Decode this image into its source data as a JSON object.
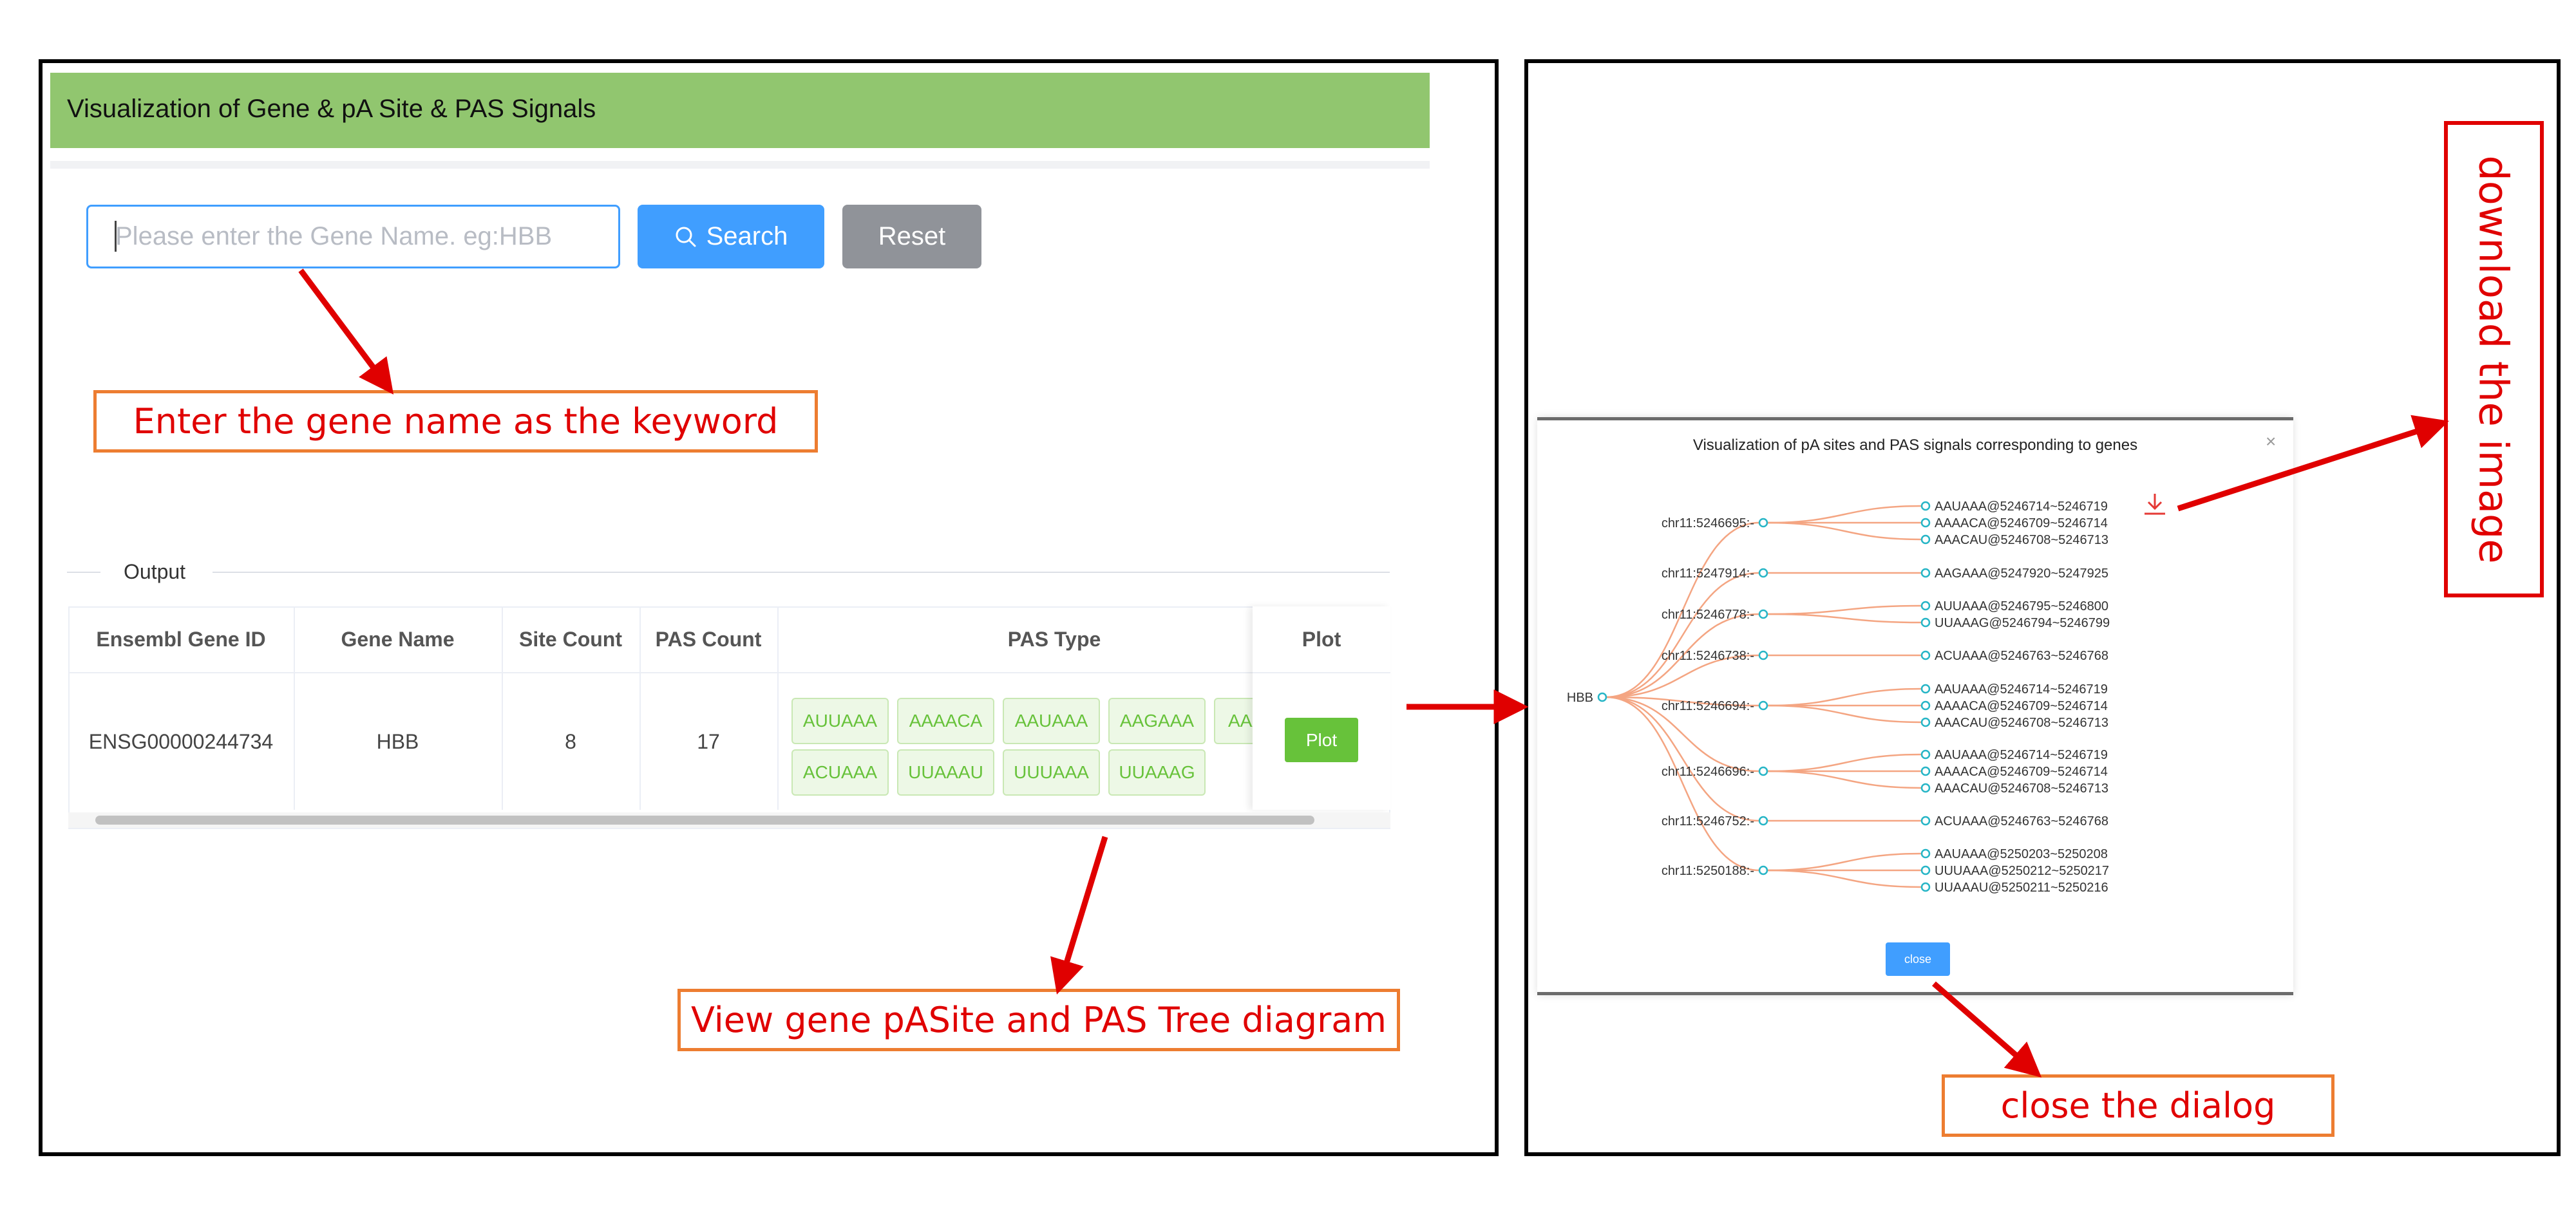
{
  "left_panel": {
    "title": "Visualization of Gene & pA Site & PAS Signals",
    "search": {
      "placeholder": "Please enter the Gene Name. eg:HBB",
      "button_label": "Search"
    },
    "reset_label": "Reset",
    "callout_search": "Enter the gene name as the keyword",
    "output_label": "Output",
    "table": {
      "headers": [
        "Ensembl Gene ID",
        "Gene Name",
        "Site Count",
        "PAS Count",
        "PAS Type",
        "Plot"
      ],
      "row": {
        "gene_id": "ENSG00000244734",
        "gene_name": "HBB",
        "site_count": "8",
        "pas_count": "17"
      },
      "pas_types_row1": [
        "AUUAAA",
        "AAAACA",
        "AAUAAA",
        "AAGAAA",
        "AAA"
      ],
      "pas_types_row2": [
        "ACUAAA",
        "UUAAAU",
        "UUUAAA",
        "UUAAAG"
      ],
      "plot_label": "Plot"
    },
    "callout_tree": "View gene pASite and PAS Tree diagram"
  },
  "dialog": {
    "title": "Visualization of pA sites and PAS signals corresponding to genes",
    "close_x": "×",
    "close_label": "close",
    "root": "HBB",
    "sites": [
      {
        "label": "chr11:5246695:-",
        "signals": [
          "AAUAAA@5246714~5246719",
          "AAAACA@5246709~5246714",
          "AAACAU@5246708~5246713"
        ]
      },
      {
        "label": "chr11:5247914:-",
        "signals": [
          "AAGAAA@5247920~5247925"
        ]
      },
      {
        "label": "chr11:5246778:-",
        "signals": [
          "AUUAAA@5246795~5246800",
          "UUAAAG@5246794~5246799"
        ]
      },
      {
        "label": "chr11:5246738:-",
        "signals": [
          "ACUAAA@5246763~5246768"
        ]
      },
      {
        "label": "chr11:5246694:-",
        "signals": [
          "AAUAAA@5246714~5246719",
          "AAAACA@5246709~5246714",
          "AAACAU@5246708~5246713"
        ]
      },
      {
        "label": "chr11:5246696:-",
        "signals": [
          "AAUAAA@5246714~5246719",
          "AAAACA@5246709~5246714",
          "AAACAU@5246708~5246713"
        ]
      },
      {
        "label": "chr11:5246752:-",
        "signals": [
          "ACUAAA@5246763~5246768"
        ]
      },
      {
        "label": "chr11:5250188:-",
        "signals": [
          "AAUAAA@5250203~5250208",
          "UUUAAA@5250212~5250217",
          "UUAAAU@5250211~5250216"
        ]
      }
    ],
    "callout_download": "download the image",
    "callout_close": "close the dialog"
  },
  "colors": {
    "accent": "#409eff",
    "header": "#91c66f",
    "tag_text": "#67c23a",
    "plot_btn": "#67c23a",
    "callout_border": "#ed7d31",
    "callout_text": "#e00000",
    "tree_line": "#f4a582",
    "tree_node": "#26b5c6"
  }
}
